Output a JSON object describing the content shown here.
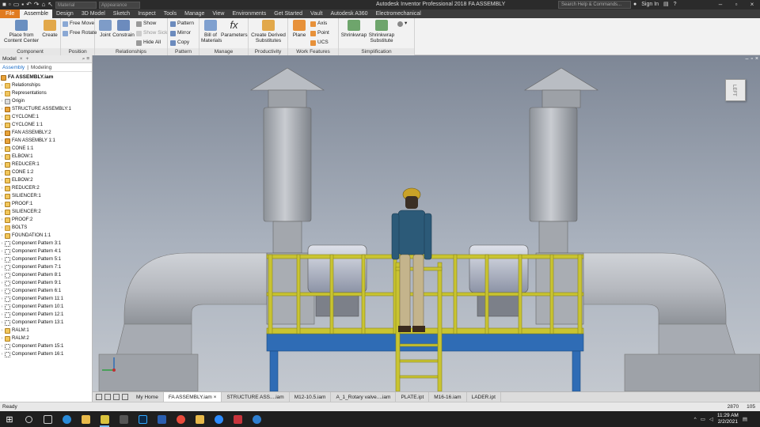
{
  "titlebar": {
    "title": "Autodesk Inventor Professional 2018   FA ASSEMBLY",
    "search_placeholder": "Search Help & Commands...",
    "signin": "Sign In",
    "material": "Material",
    "appearance": "Appearance"
  },
  "tabs": [
    "File",
    "Assemble",
    "Design",
    "3D Model",
    "Sketch",
    "Inspect",
    "Tools",
    "Manage",
    "View",
    "Environments",
    "Get Started",
    "Vault",
    "Autodesk A360",
    "Electromechanical"
  ],
  "ribbon": {
    "component": {
      "title": "Component",
      "place": "Place from Content Center",
      "create": "Create"
    },
    "position": {
      "title": "Position",
      "free_move": "Free Move",
      "free_rotate": "Free Rotate"
    },
    "relationships": {
      "title": "Relationships",
      "joint": "Joint",
      "constrain": "Constrain",
      "show": "Show",
      "show_sick": "Show Sick",
      "hide_all": "Hide All"
    },
    "pattern": {
      "title": "Pattern",
      "pattern": "Pattern",
      "mirror": "Mirror",
      "copy": "Copy"
    },
    "manage": {
      "title": "Manage",
      "bom": "Bill of Materials",
      "parameters": "Parameters"
    },
    "productivity": {
      "title": "Productivity",
      "create_derived": "Create Derived Substitutes"
    },
    "work_features": {
      "title": "Work Features",
      "plane": "Plane",
      "axis": "Axis",
      "point": "Point",
      "ucs": "UCS"
    },
    "simplification": {
      "title": "Simplification",
      "shrinkwrap": "Shrinkwrap",
      "shrinkwrap_sub": "Shrinkwrap Substitute"
    }
  },
  "browser": {
    "title": "Model",
    "tab_assembly": "Assembly",
    "tab_modeling": "Modeling",
    "root": "FA ASSEMBLY.iam",
    "items": [
      {
        "label": "Relationships",
        "icon": "folder"
      },
      {
        "label": "Representations",
        "icon": "folder"
      },
      {
        "label": "Origin",
        "icon": "origin"
      },
      {
        "label": "STRUCTURE ASSEMBLY:1",
        "icon": "asm"
      },
      {
        "label": "CYCLONE:1",
        "icon": "part"
      },
      {
        "label": "CYCLONE 1:1",
        "icon": "part"
      },
      {
        "label": "FAN ASSEMBLY:2",
        "icon": "asm"
      },
      {
        "label": "FAN ASSEMBLY 1:1",
        "icon": "asm"
      },
      {
        "label": "CONE 1:1",
        "icon": "part"
      },
      {
        "label": "ELBOW:1",
        "icon": "part"
      },
      {
        "label": "REDUCER:1",
        "icon": "part"
      },
      {
        "label": "CONE 1:2",
        "icon": "part"
      },
      {
        "label": "ELBOW:2",
        "icon": "part"
      },
      {
        "label": "REDUCER:2",
        "icon": "part"
      },
      {
        "label": "SILIENCER:1",
        "icon": "part"
      },
      {
        "label": "PROOF:1",
        "icon": "part"
      },
      {
        "label": "SILIENCER:2",
        "icon": "part"
      },
      {
        "label": "PROOF:2",
        "icon": "part"
      },
      {
        "label": "BOLTS",
        "icon": "folder"
      },
      {
        "label": "FOUNDATION 1:1",
        "icon": "part"
      },
      {
        "label": "Component Pattern 3:1",
        "icon": "pattern"
      },
      {
        "label": "Component Pattern 4:1",
        "icon": "pattern"
      },
      {
        "label": "Component Pattern 5:1",
        "icon": "pattern"
      },
      {
        "label": "Component Pattern 7:1",
        "icon": "pattern"
      },
      {
        "label": "Component Pattern 8:1",
        "icon": "pattern"
      },
      {
        "label": "Component Pattern 9:1",
        "icon": "pattern"
      },
      {
        "label": "Component Pattern 6:1",
        "icon": "pattern"
      },
      {
        "label": "Component Pattern 11:1",
        "icon": "pattern"
      },
      {
        "label": "Component Pattern 10:1",
        "icon": "pattern"
      },
      {
        "label": "Component Pattern 12:1",
        "icon": "pattern"
      },
      {
        "label": "Component Pattern 13:1",
        "icon": "pattern"
      },
      {
        "label": "RALM:1",
        "icon": "part"
      },
      {
        "label": "RALM:2",
        "icon": "part"
      },
      {
        "label": "Component Pattern 15:1",
        "icon": "pattern"
      },
      {
        "label": "Component Pattern 16:1",
        "icon": "pattern"
      }
    ]
  },
  "viewcube": {
    "label": "LEFT"
  },
  "doctabs": [
    "My Home",
    "FA ASSEMBLY.iam",
    "STRUCTURE ASS....iam",
    "M12-10.5.iam",
    "A_1_Rotary valve....iam",
    "PLATE.ipt",
    "M16-16.iam",
    "LADER.ipt"
  ],
  "doctabs_active": 1,
  "status": {
    "left": "Ready",
    "count1": "2870",
    "count2": "105"
  },
  "taskbar": {
    "time": "11:29 AM",
    "date": "2/2/2021"
  },
  "colors": {
    "file_tab": "#e07b20",
    "railing": "#c9c431",
    "beam": "#2f6cb5",
    "duct": "#b8bcc3"
  }
}
